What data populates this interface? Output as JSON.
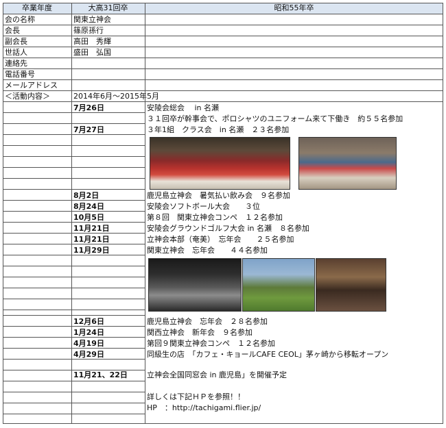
{
  "header": {
    "col1": "卒業年度",
    "col2": "大高31回卒",
    "col3": "昭和55年卒"
  },
  "info_rows": [
    {
      "label": "会の名称",
      "value": "関東立神会"
    },
    {
      "label": "会長",
      "value": "篠原孫行"
    },
    {
      "label": "副会長",
      "value": "高田　秀輝"
    },
    {
      "label": "世話人",
      "value": "盛田　弘国"
    },
    {
      "label": "連絡先",
      "value": ""
    },
    {
      "label": "電話番号",
      "value": ""
    },
    {
      "label": "メールアドレス",
      "value": ""
    }
  ],
  "activity": {
    "label": "＜活動内容＞",
    "period": "2014年6月〜2015年5月"
  },
  "events": [
    {
      "date": "7月26日",
      "text": "安陵会総会　 in 名瀬"
    },
    {
      "date": "",
      "text": "３１回卒が幹事会で、ポロシャツのユニフォーム来て下働き　約５５名参加"
    },
    {
      "date": "7月27日",
      "text": "３年1組　クラス会　in 名瀬　２３名参加"
    },
    {
      "date": "8月2日",
      "text": "鹿児島立神会　暑気払い飲み会　９名参加"
    },
    {
      "date": "8月24日",
      "text": "安陵会ソフトボール大会　　３位"
    },
    {
      "date": "10月5日",
      "text": "第８回　関東立神会コンペ　１２名参加"
    },
    {
      "date": "11月21日",
      "text": "安陵会グラウンドゴルフ大会 in 名瀬　８名参加"
    },
    {
      "date": "11月21日",
      "text": "立神会本部（奄美）　忘年会　　２５名参加"
    },
    {
      "date": "11月29日",
      "text": "関東立神会　忘年会　　４４名参加"
    },
    {
      "date": "12月6日",
      "text": "鹿児島立神会　忘年会　２８名参加"
    },
    {
      "date": "1月24日",
      "text": "関西立神会　新年会　９名参加"
    },
    {
      "date": "4月19日",
      "text": "第回９関東立神会コンペ　１２名参加"
    },
    {
      "date": "4月29日",
      "text": "同級生の店　「カフェ・キョールCAFE CEOL」茅ヶ崎から移転オープン"
    },
    {
      "date": "11月21、22日",
      "text": "立神会全国同窓会 in 鹿児島」を開催予定"
    }
  ],
  "footer": {
    "note": "詳しくは下記ＨＰを参照！！",
    "hp": "HP　：http://tachigami.flier.jp/"
  }
}
